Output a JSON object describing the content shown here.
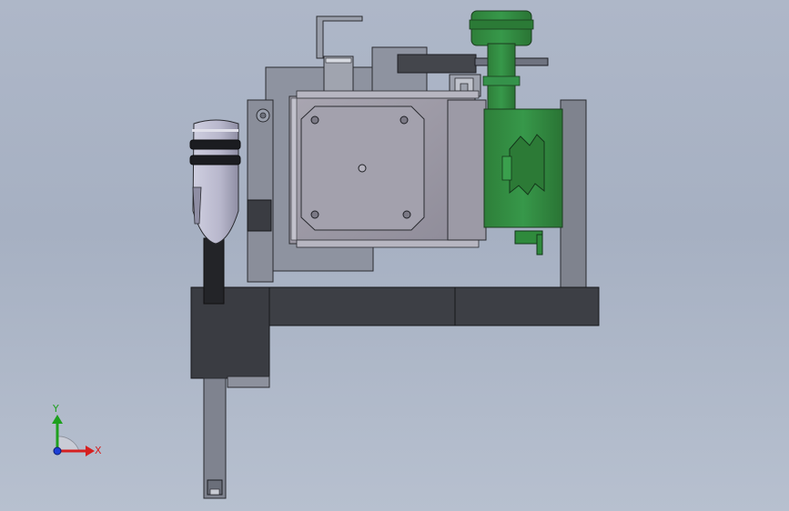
{
  "viewport": {
    "background_top": "#aeb7c8",
    "background_bottom": "#b7c0cf"
  },
  "model": {
    "view": "front",
    "colors": {
      "gray_part": "#8a8f9b",
      "dark_gray_part": "#4a4c52",
      "green_part": "#2f8a3c",
      "steel": "#c7c9d2",
      "outline": "#1e1f24"
    }
  },
  "triad": {
    "x_label": "X",
    "y_label": "Y",
    "x_color": "#d62020",
    "y_color": "#1ea01e",
    "z_color": "#1d3fd6"
  }
}
